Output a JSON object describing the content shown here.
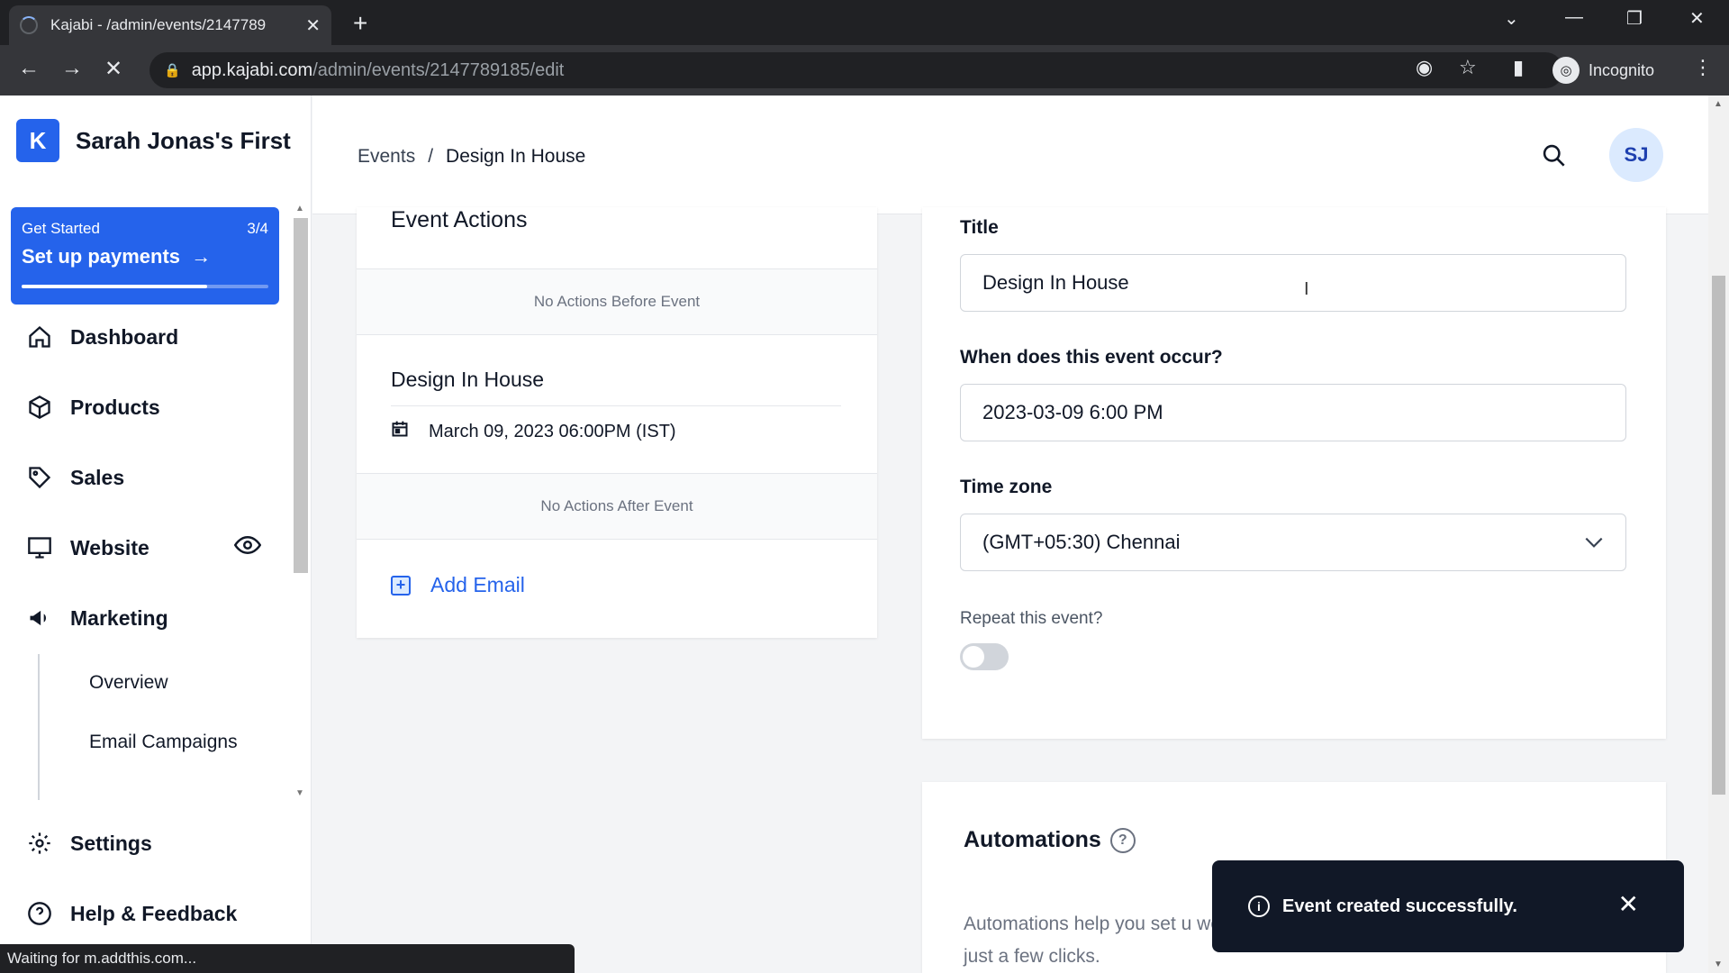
{
  "browser": {
    "tab_title": "Kajabi - /admin/events/2147789",
    "url_host": "app.kajabi.com",
    "url_path": "/admin/events/2147789185/edit",
    "incognito_label": "Incognito",
    "status_text": "Waiting for m.addthis.com..."
  },
  "sidebar": {
    "site_name": "Sarah Jonas's First",
    "get_started": {
      "label": "Get Started",
      "count": "3/4",
      "action": "Set up payments",
      "progress": 0.75
    },
    "items": [
      {
        "label": "Dashboard"
      },
      {
        "label": "Products"
      },
      {
        "label": "Sales"
      },
      {
        "label": "Website"
      },
      {
        "label": "Marketing"
      }
    ],
    "marketing_sub": [
      {
        "label": "Overview"
      },
      {
        "label": "Email Campaigns"
      }
    ],
    "bottom": [
      {
        "label": "Settings"
      },
      {
        "label": "Help & Feedback"
      }
    ]
  },
  "header": {
    "breadcrumb_root": "Events",
    "breadcrumb_sep": "/",
    "breadcrumb_current": "Design In House",
    "avatar_initials": "SJ"
  },
  "event_actions": {
    "heading": "Event Actions",
    "before": "No Actions Before Event",
    "event_title": "Design In House",
    "event_date": "March 09, 2023 06:00PM (IST)",
    "after": "No Actions After Event",
    "add_email": "Add Email"
  },
  "form": {
    "title_label": "Title",
    "title_value": "Design In House",
    "when_label": "When does this event occur?",
    "when_value": "2023-03-09 6:00 PM",
    "tz_label": "Time zone",
    "tz_value": "(GMT+05:30) Chennai",
    "repeat_label": "Repeat this event?"
  },
  "automations": {
    "title": "Automations",
    "description": "Automations help you set u workflow with just a few clicks."
  },
  "toast": {
    "message": "Event created successfully."
  },
  "colors": {
    "accent": "#2563eb",
    "toast_bg": "#111827"
  }
}
